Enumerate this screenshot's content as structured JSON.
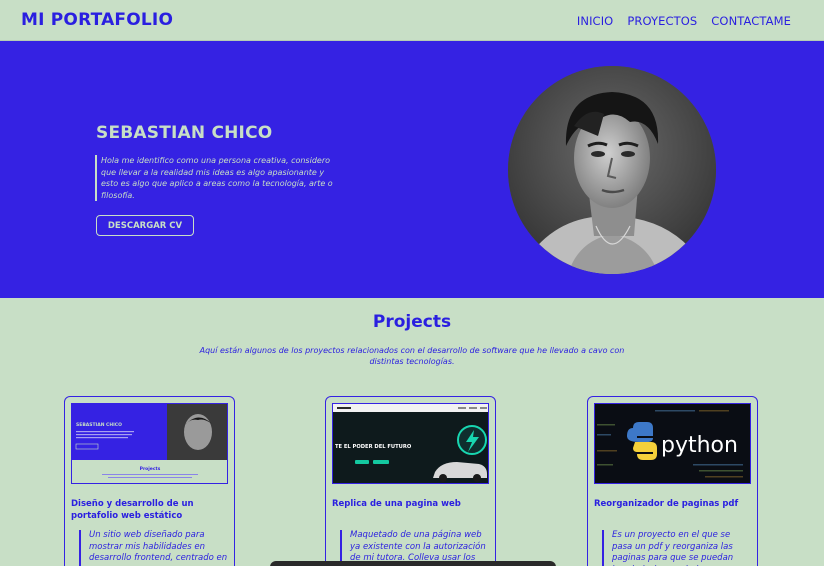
{
  "nav": {
    "brand": "MI PORTAFOLIO",
    "links": [
      "INICIO",
      "PROYECTOS",
      "CONTACTAME"
    ]
  },
  "hero": {
    "name": "SEBASTIAN CHICO",
    "bio": "Hola me identifico como una persona creativa, considero que llevar a la realidad mis ideas es algo apasionante y esto es algo que aplico a areas como la tecnología, arte o filosofía.",
    "cv_button": "DESCARGAR CV"
  },
  "projects": {
    "title": "Projects",
    "subtitle": "Aquí están algunos de los proyectos relacionados con el desarrollo de software que he llevado a cavo con distintas tecnologías.",
    "cards": [
      {
        "title": "Diseño y desarrollo de un portafolio web estático",
        "description": "Un sitio web diseñado para mostrar mis habilidades en desarrollo frontend, centrado en una",
        "thumb_name": "SEBASTIAN CHICO",
        "thumb_section": "Projects"
      },
      {
        "title": "Replica de una pagina web",
        "description": "Maquetado de una página web ya existente con la autorización de mi tutora. Colleva usar los",
        "thumb_headline": "TE EL PODER DEL FUTURO"
      },
      {
        "title": "Reorganizador de paginas pdf",
        "description": "Es un proyecto en el que se pasa un pdf y reorganiza las paginas para que se puedan imprimir dos por hoja",
        "thumb_logo": "python"
      }
    ]
  },
  "colors": {
    "background": "#c8dfc6",
    "accent": "#3522e3",
    "text": "#2a1fe0"
  }
}
